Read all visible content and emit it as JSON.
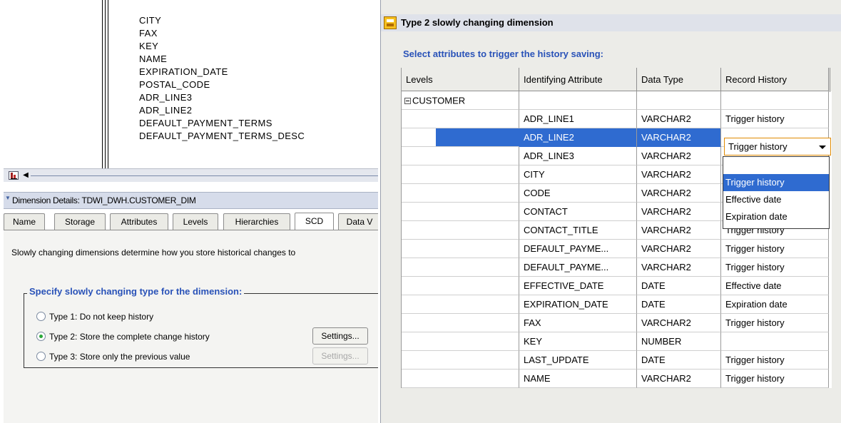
{
  "left_panel": {
    "attributes": [
      "CITY",
      "FAX",
      "KEY",
      "NAME",
      "EXPIRATION_DATE",
      "POSTAL_CODE",
      "ADR_LINE3",
      "ADR_LINE2",
      "DEFAULT_PAYMENT_TERMS",
      "DEFAULT_PAYMENT_TERMS_DESC"
    ],
    "details_title": "Dimension Details: TDWI_DWH.CUSTOMER_DIM",
    "tabs": [
      "Name",
      "Storage",
      "Attributes",
      "Levels",
      "Hierarchies",
      "SCD",
      "Data V"
    ],
    "active_tab": "SCD",
    "scd_description": "Slowly changing dimensions determine how you store historical changes to",
    "group_label": "Specify slowly changing type for the dimension:",
    "options": [
      {
        "label": "Type 1: Do not keep history",
        "checked": false
      },
      {
        "label": "Type 2: Store the complete change history",
        "checked": true
      },
      {
        "label": "Type 3: Store only the previous value",
        "checked": false
      }
    ],
    "settings_label": "Settings..."
  },
  "dialog": {
    "title": "Type 2 slowly changing dimension",
    "instruction": "Select attributes to trigger the history saving:",
    "columns": [
      "Levels",
      "Identifying Attribute",
      "Data Type",
      "Record History"
    ],
    "level": "CUSTOMER",
    "rows": [
      {
        "attribute": "ADR_LINE1",
        "type": "VARCHAR2",
        "history": "Trigger history"
      },
      {
        "attribute": "ADR_LINE2",
        "type": "VARCHAR2",
        "history": ""
      },
      {
        "attribute": "ADR_LINE3",
        "type": "VARCHAR2",
        "history": ""
      },
      {
        "attribute": "CITY",
        "type": "VARCHAR2",
        "history": ""
      },
      {
        "attribute": "CODE",
        "type": "VARCHAR2",
        "history": ""
      },
      {
        "attribute": "CONTACT",
        "type": "VARCHAR2",
        "history": ""
      },
      {
        "attribute": "CONTACT_TITLE",
        "type": "VARCHAR2",
        "history": "Trigger history"
      },
      {
        "attribute": "DEFAULT_PAYME...",
        "type": "VARCHAR2",
        "history": "Trigger history"
      },
      {
        "attribute": "DEFAULT_PAYME...",
        "type": "VARCHAR2",
        "history": "Trigger history"
      },
      {
        "attribute": "EFFECTIVE_DATE",
        "type": "DATE",
        "history": "Effective date"
      },
      {
        "attribute": "EXPIRATION_DATE",
        "type": "DATE",
        "history": "Expiration date"
      },
      {
        "attribute": "FAX",
        "type": "VARCHAR2",
        "history": "Trigger history"
      },
      {
        "attribute": "KEY",
        "type": "NUMBER",
        "history": ""
      },
      {
        "attribute": "LAST_UPDATE",
        "type": "DATE",
        "history": "Trigger history"
      },
      {
        "attribute": "NAME",
        "type": "VARCHAR2",
        "history": "Trigger history"
      }
    ],
    "combo_value": "Trigger history",
    "dropdown_options": [
      "",
      "Trigger history",
      "Effective date",
      "Expiration date"
    ],
    "dropdown_highlight": "Trigger history"
  }
}
